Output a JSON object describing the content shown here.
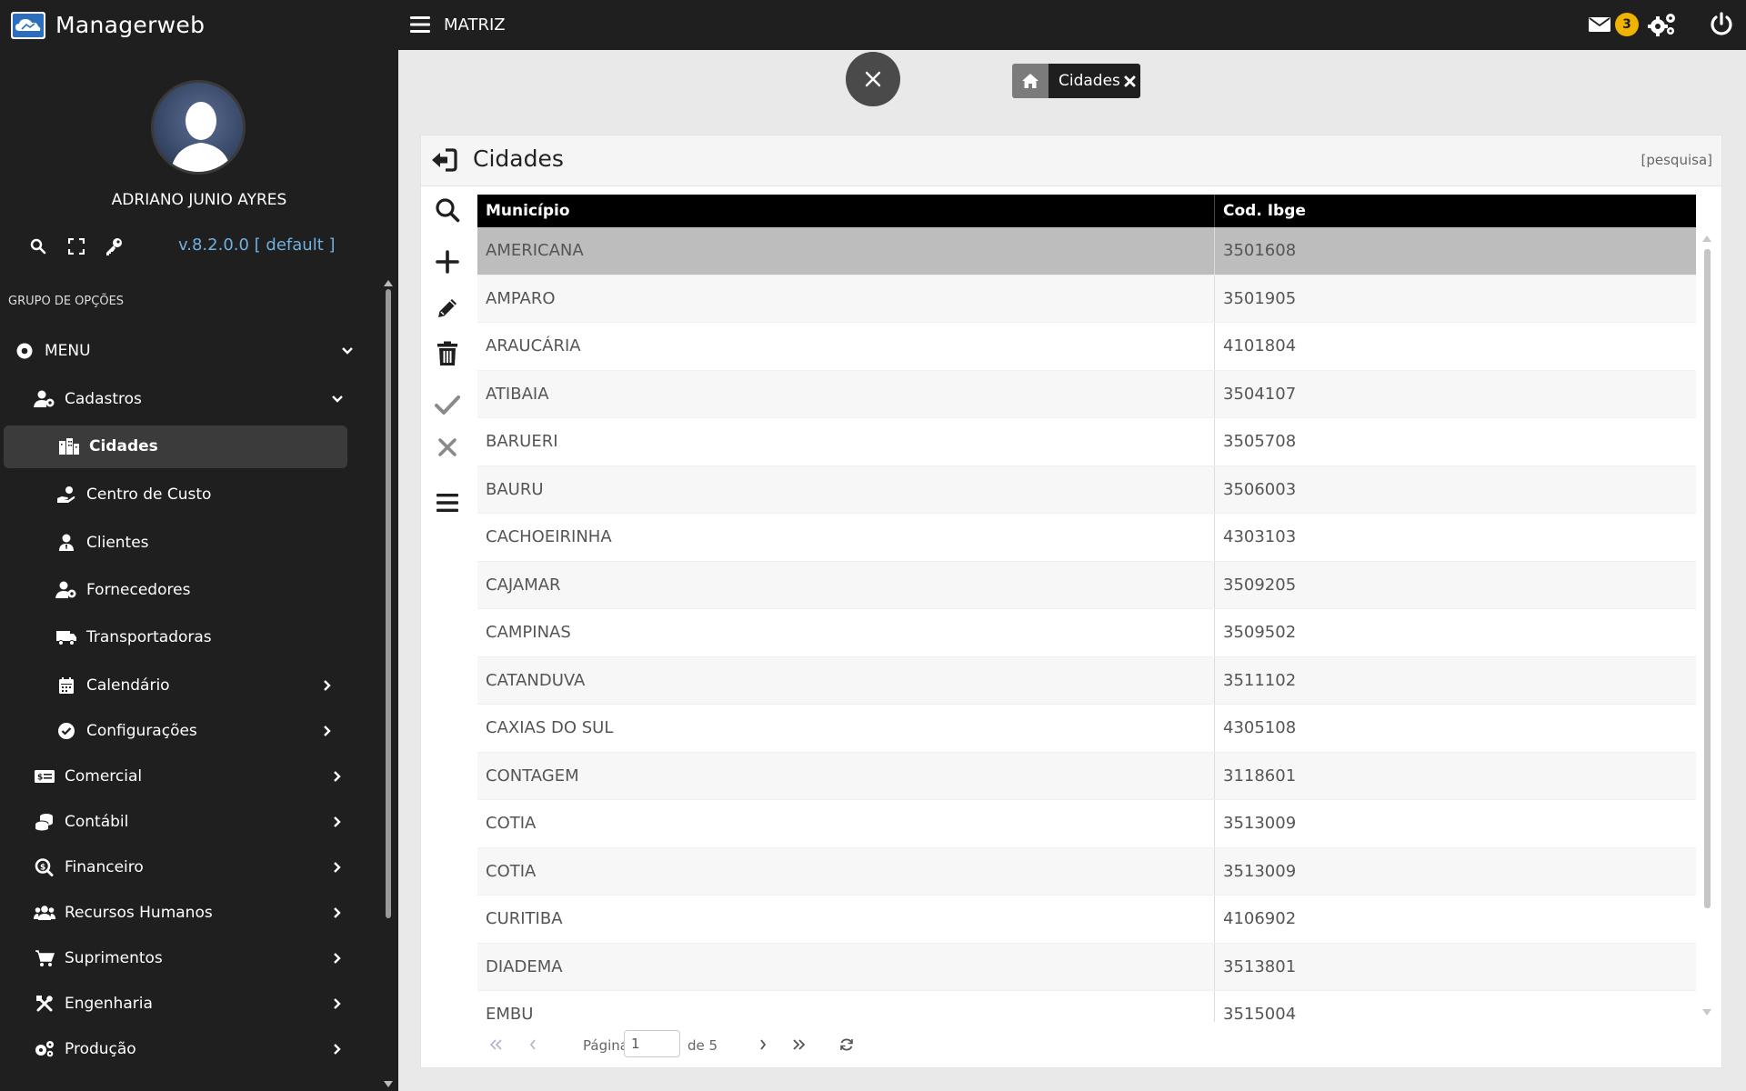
{
  "brand": {
    "name": "Managerweb"
  },
  "user": {
    "name": "ADRIANO JUNIO AYRES",
    "version": "v.8.2.0.0 [ default ]"
  },
  "sidebar": {
    "group_title": "GRUPO DE OPÇÕES",
    "menu_label": "MENU",
    "items": [
      {
        "label": "Cadastros",
        "icon": "user-gear-icon"
      },
      {
        "label": "Cidades",
        "icon": "city-icon"
      },
      {
        "label": "Centro de Custo",
        "icon": "hand-coin-icon"
      },
      {
        "label": "Clientes",
        "icon": "user-tie-icon"
      },
      {
        "label": "Fornecedores",
        "icon": "user-gear-icon"
      },
      {
        "label": "Transportadoras",
        "icon": "truck-icon"
      },
      {
        "label": "Calendário",
        "icon": "calendar-icon"
      },
      {
        "label": "Configurações",
        "icon": "check-circle-icon"
      },
      {
        "label": "Comercial",
        "icon": "money-card-icon"
      },
      {
        "label": "Contábil",
        "icon": "coins-icon"
      },
      {
        "label": "Financeiro",
        "icon": "search-dollar-icon"
      },
      {
        "label": "Recursos Humanos",
        "icon": "users-icon"
      },
      {
        "label": "Suprimentos",
        "icon": "cart-icon"
      },
      {
        "label": "Engenharia",
        "icon": "tools-icon"
      },
      {
        "label": "Produção",
        "icon": "gears-icon"
      }
    ]
  },
  "topbar": {
    "branch": "MATRIZ",
    "mail_count": "3"
  },
  "tabs": {
    "active": "Cidades"
  },
  "panel": {
    "title": "Cidades",
    "search_link": "[pesquisa]",
    "columns": [
      "Município",
      "Cod. Ibge"
    ],
    "rows": [
      [
        "AMERICANA",
        "3501608"
      ],
      [
        "AMPARO",
        "3501905"
      ],
      [
        "ARAUCÁRIA",
        "4101804"
      ],
      [
        "ATIBAIA",
        "3504107"
      ],
      [
        "BARUERI",
        "3505708"
      ],
      [
        "BAURU",
        "3506003"
      ],
      [
        "CACHOEIRINHA",
        "4303103"
      ],
      [
        "CAJAMAR",
        "3509205"
      ],
      [
        "CAMPINAS",
        "3509502"
      ],
      [
        "CATANDUVA",
        "3511102"
      ],
      [
        "CAXIAS DO SUL",
        "4305108"
      ],
      [
        "CONTAGEM",
        "3118601"
      ],
      [
        "COTIA",
        "3513009"
      ],
      [
        "COTIA",
        "3513009"
      ],
      [
        "CURITIBA",
        "4106902"
      ],
      [
        "DIADEMA",
        "3513801"
      ],
      [
        "EMBU",
        "3515004"
      ]
    ]
  },
  "pager": {
    "page_label": "Página",
    "page_value": "1",
    "of_label": "de 5"
  }
}
